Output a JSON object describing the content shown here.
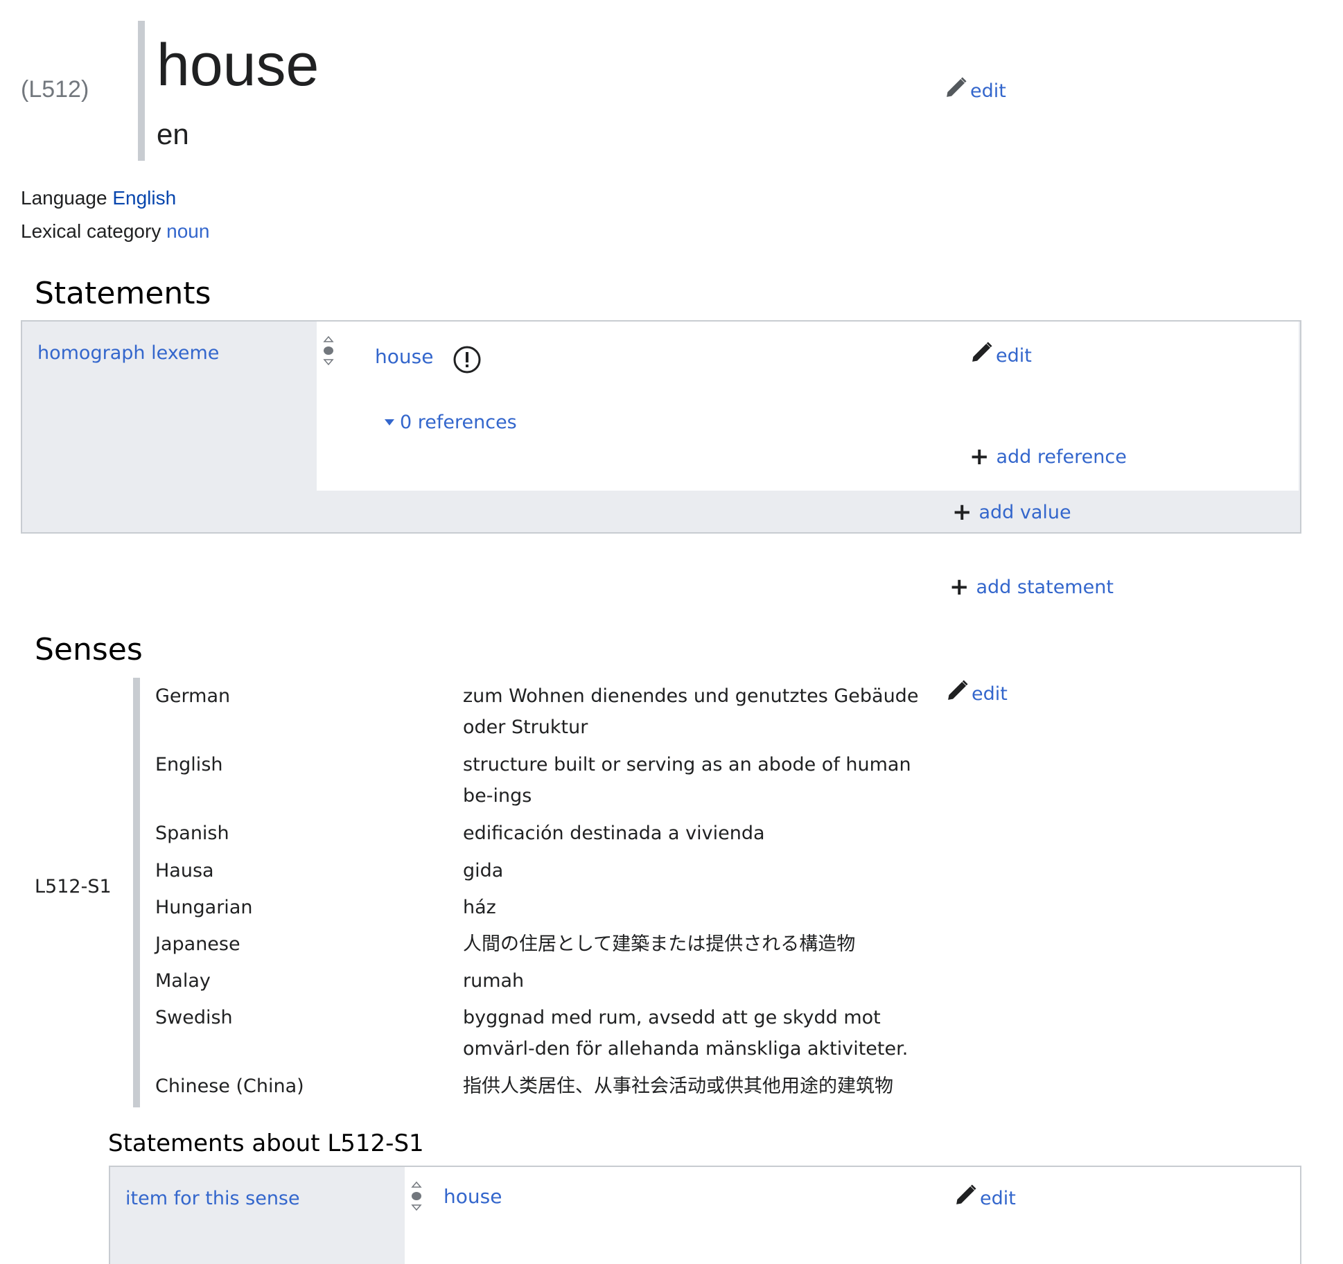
{
  "header": {
    "lexeme_id": "(L512)",
    "lemma": "house",
    "lemma_language": "en",
    "edit_label": "edit"
  },
  "meta": {
    "language_label": "Language",
    "language_value": "English",
    "lexical_category_label": "Lexical category",
    "lexical_category_value": "noun"
  },
  "statements": {
    "heading": "Statements",
    "groups": [
      {
        "property": "homograph lexeme",
        "value": "house",
        "references": "0 references",
        "edit_label": "edit",
        "add_reference_label": "add reference",
        "add_value_label": "add value"
      }
    ],
    "add_statement_label": "add statement"
  },
  "senses": {
    "heading": "Senses",
    "sense_id": "L512-S1",
    "edit_label": "edit",
    "glosses": [
      {
        "language": "German",
        "text": "zum Wohnen dienendes und genutztes Gebäude oder Struktur"
      },
      {
        "language": "English",
        "text": "structure built or serving as an abode of human be-ings"
      },
      {
        "language": "Spanish",
        "text": "edificación destinada a vivienda"
      },
      {
        "language": "Hausa",
        "text": "gida"
      },
      {
        "language": "Hungarian",
        "text": "ház"
      },
      {
        "language": "Japanese",
        "text": "人間の住居として建築または提供される構造物"
      },
      {
        "language": "Malay",
        "text": "rumah"
      },
      {
        "language": "Swedish",
        "text": "byggnad med rum, avsedd att ge skydd mot omvärl-den för allehanda mänskliga aktiviteter."
      },
      {
        "language": "Chinese (China)",
        "text": "指供人类居住、从事社会活动或供其他用途的建筑物"
      }
    ],
    "statements_heading": "Statements about L512-S1",
    "statements": [
      {
        "property": "item for this sense",
        "value": "house",
        "edit_label": "edit"
      }
    ]
  },
  "colors": {
    "link": "#3366cc",
    "panel_gray": "#eaecf0",
    "bar_gray": "#c8ccd1"
  }
}
